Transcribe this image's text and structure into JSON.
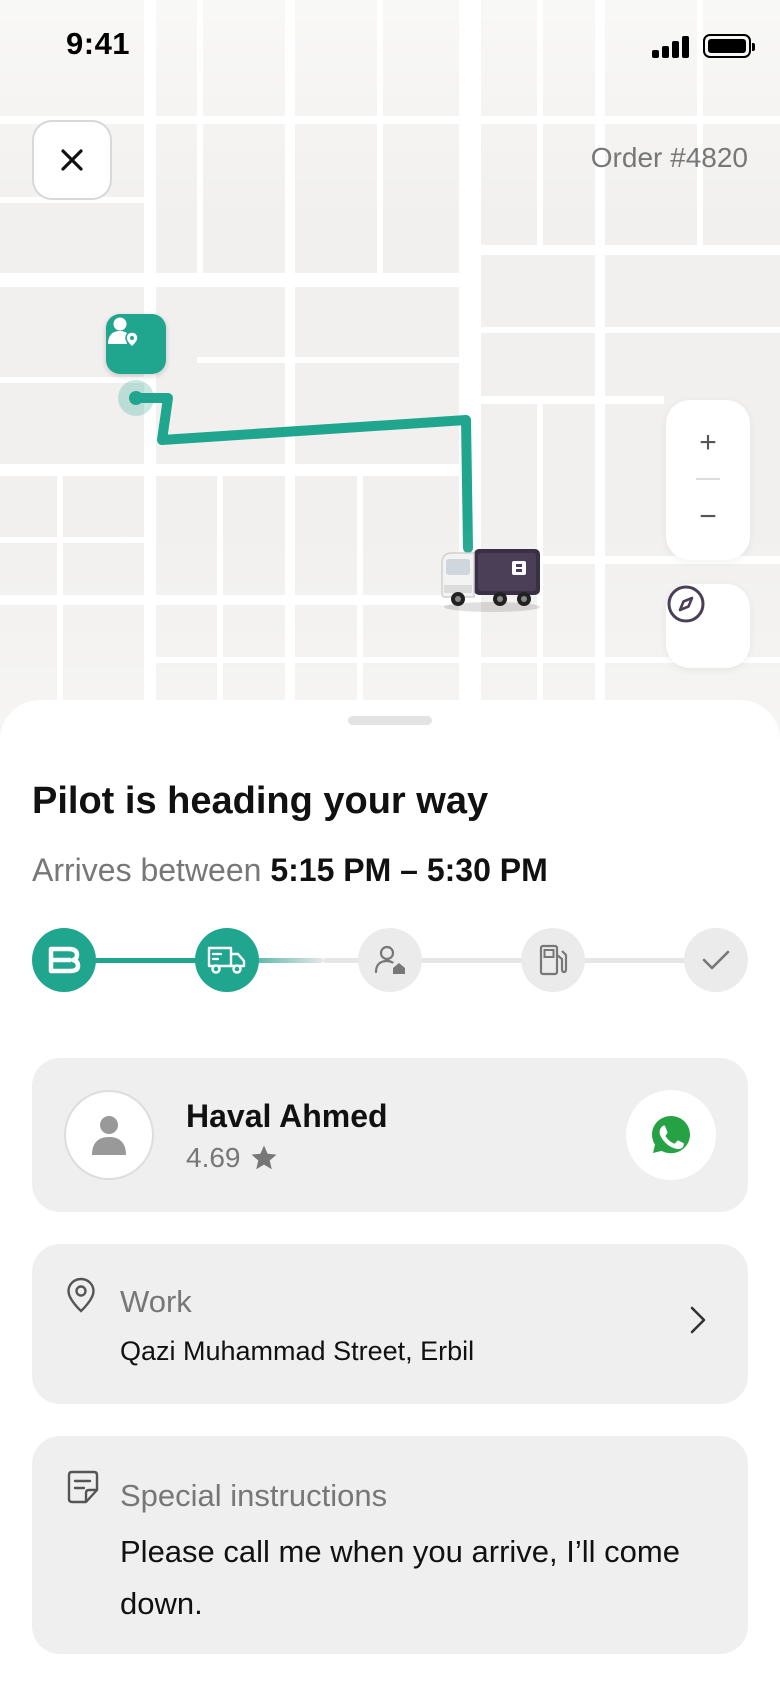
{
  "status_bar": {
    "time": "9:41"
  },
  "header": {
    "order_number": "Order #4820"
  },
  "map": {
    "zoom_in_label": "+",
    "zoom_out_label": "−",
    "route_color": "#20a58f"
  },
  "tracking": {
    "title": "Pilot is heading your way",
    "eta_prefix": "Arrives between",
    "eta_window": "5:15 PM – 5:30 PM",
    "steps": [
      {
        "icon": "brand-b-icon",
        "state": "done"
      },
      {
        "icon": "truck-icon",
        "state": "done"
      },
      {
        "icon": "user-home-icon",
        "state": "todo"
      },
      {
        "icon": "fuel-pump-icon",
        "state": "todo"
      },
      {
        "icon": "check-icon",
        "state": "todo"
      }
    ]
  },
  "driver": {
    "name": "Haval Ahmed",
    "rating": "4.69",
    "contact_icon": "whatsapp-icon",
    "whatsapp_color": "#25a244"
  },
  "address": {
    "label": "Work",
    "value": "Qazi Muhammad Street, Erbil"
  },
  "notes": {
    "label": "Special instructions",
    "value": "Please call me when you arrive, I’ll come down."
  },
  "colors": {
    "accent": "#20a58f",
    "muted_text": "#777777",
    "card_bg": "#efefef"
  }
}
